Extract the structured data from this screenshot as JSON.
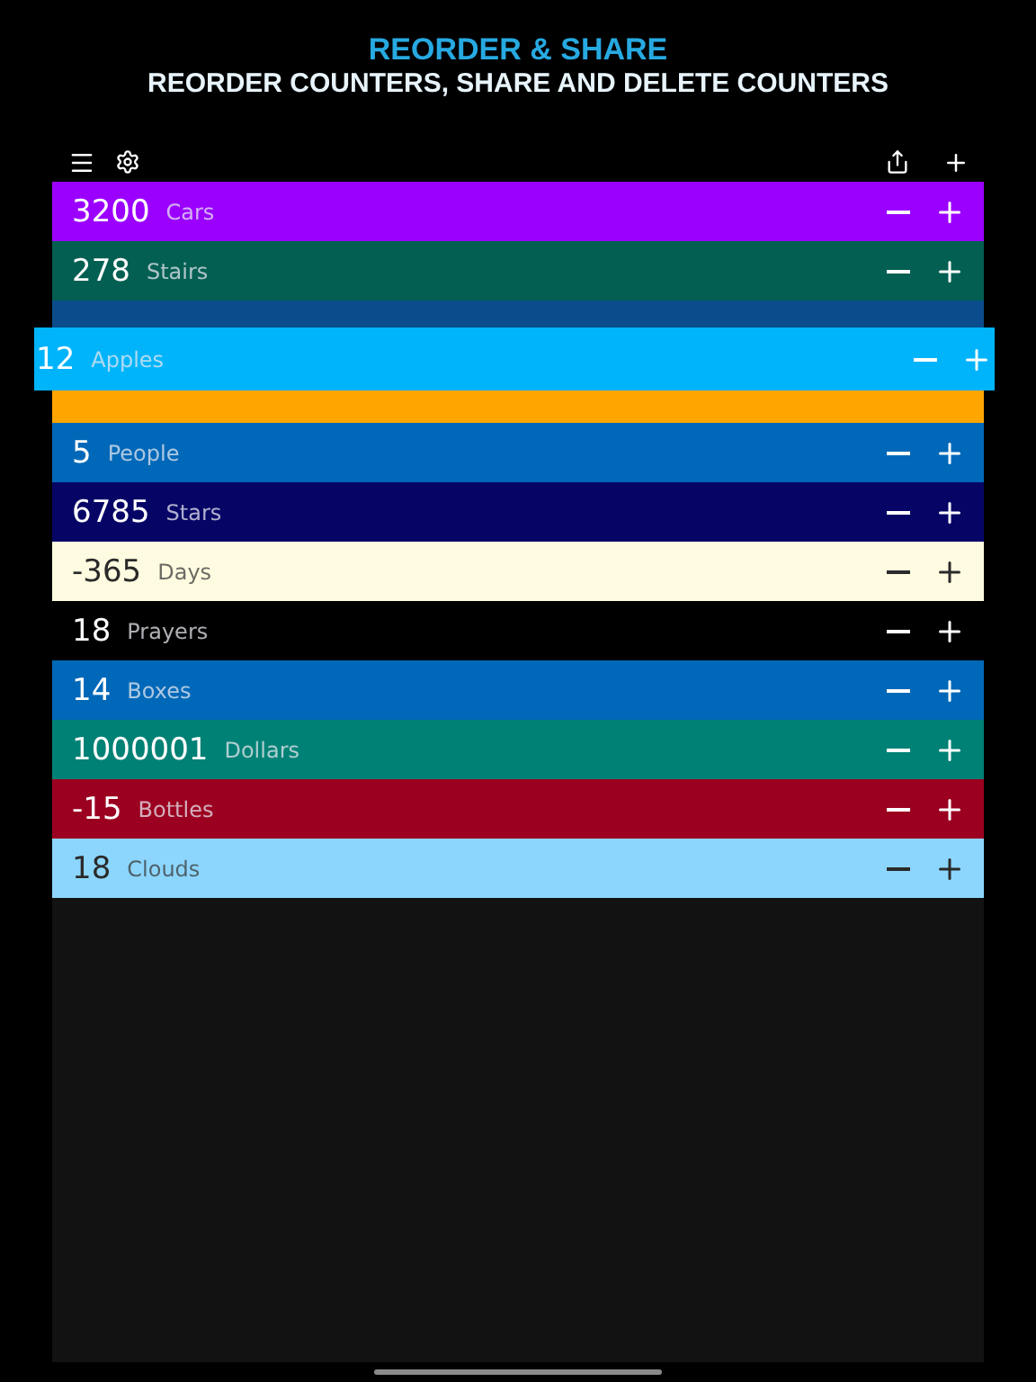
{
  "header": {
    "title": "REORDER & SHARE",
    "subtitle": "REORDER COUNTERS, SHARE AND DELETE COUNTERS"
  },
  "counters": [
    {
      "kind": "row",
      "value": "3200",
      "name": "Cars",
      "color": "#9b00ff"
    },
    {
      "kind": "row",
      "value": "278",
      "name": "Stairs",
      "color": "#025f52"
    },
    {
      "kind": "dragged",
      "value": "12",
      "name": "Apples",
      "color": "#00b4fb"
    },
    {
      "kind": "covered",
      "color": "#ffa500"
    },
    {
      "kind": "row",
      "value": "5",
      "name": "People",
      "color": "#0068b8"
    },
    {
      "kind": "row",
      "value": "6785",
      "name": "Stars",
      "color": "#060566"
    },
    {
      "kind": "row",
      "value": "-365",
      "name": "Days",
      "color": "#fffbe0"
    },
    {
      "kind": "row",
      "value": "18",
      "name": "Prayers",
      "color": "#000000"
    },
    {
      "kind": "row",
      "value": "14",
      "name": "Boxes",
      "color": "#0068b8"
    },
    {
      "kind": "row",
      "value": "1000001",
      "name": "Dollars",
      "color": "#008175"
    },
    {
      "kind": "row",
      "value": "-15",
      "name": "Bottles",
      "color": "#9b0020"
    },
    {
      "kind": "row",
      "value": "18",
      "name": "Clouds",
      "color": "#8cd6fe"
    }
  ]
}
